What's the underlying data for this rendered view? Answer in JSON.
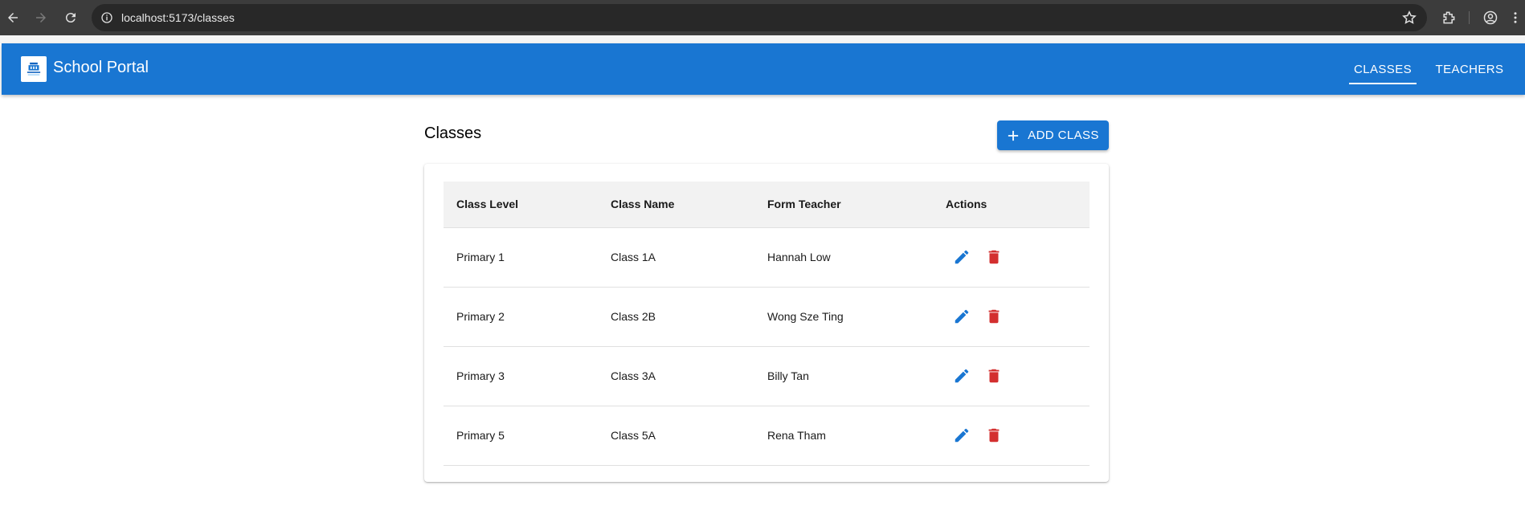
{
  "browser": {
    "url": "localhost:5173/classes"
  },
  "appbar": {
    "title": "School Portal",
    "tabs": [
      {
        "label": "CLASSES",
        "active": true
      },
      {
        "label": "TEACHERS",
        "active": false
      }
    ],
    "color": "#1976d2"
  },
  "main": {
    "title": "Classes",
    "add_button_label": "ADD CLASS"
  },
  "table": {
    "headers": [
      "Class Level",
      "Class Name",
      "Form Teacher",
      "Actions"
    ],
    "rows": [
      {
        "level": "Primary 1",
        "name": "Class 1A",
        "teacher": "Hannah Low"
      },
      {
        "level": "Primary 2",
        "name": "Class 2B",
        "teacher": "Wong Sze Ting"
      },
      {
        "level": "Primary 3",
        "name": "Class 3A",
        "teacher": "Billy Tan"
      },
      {
        "level": "Primary 5",
        "name": "Class 5A",
        "teacher": "Rena Tham"
      }
    ],
    "edit_color": "#1976d2",
    "delete_color": "#d32f2f"
  }
}
